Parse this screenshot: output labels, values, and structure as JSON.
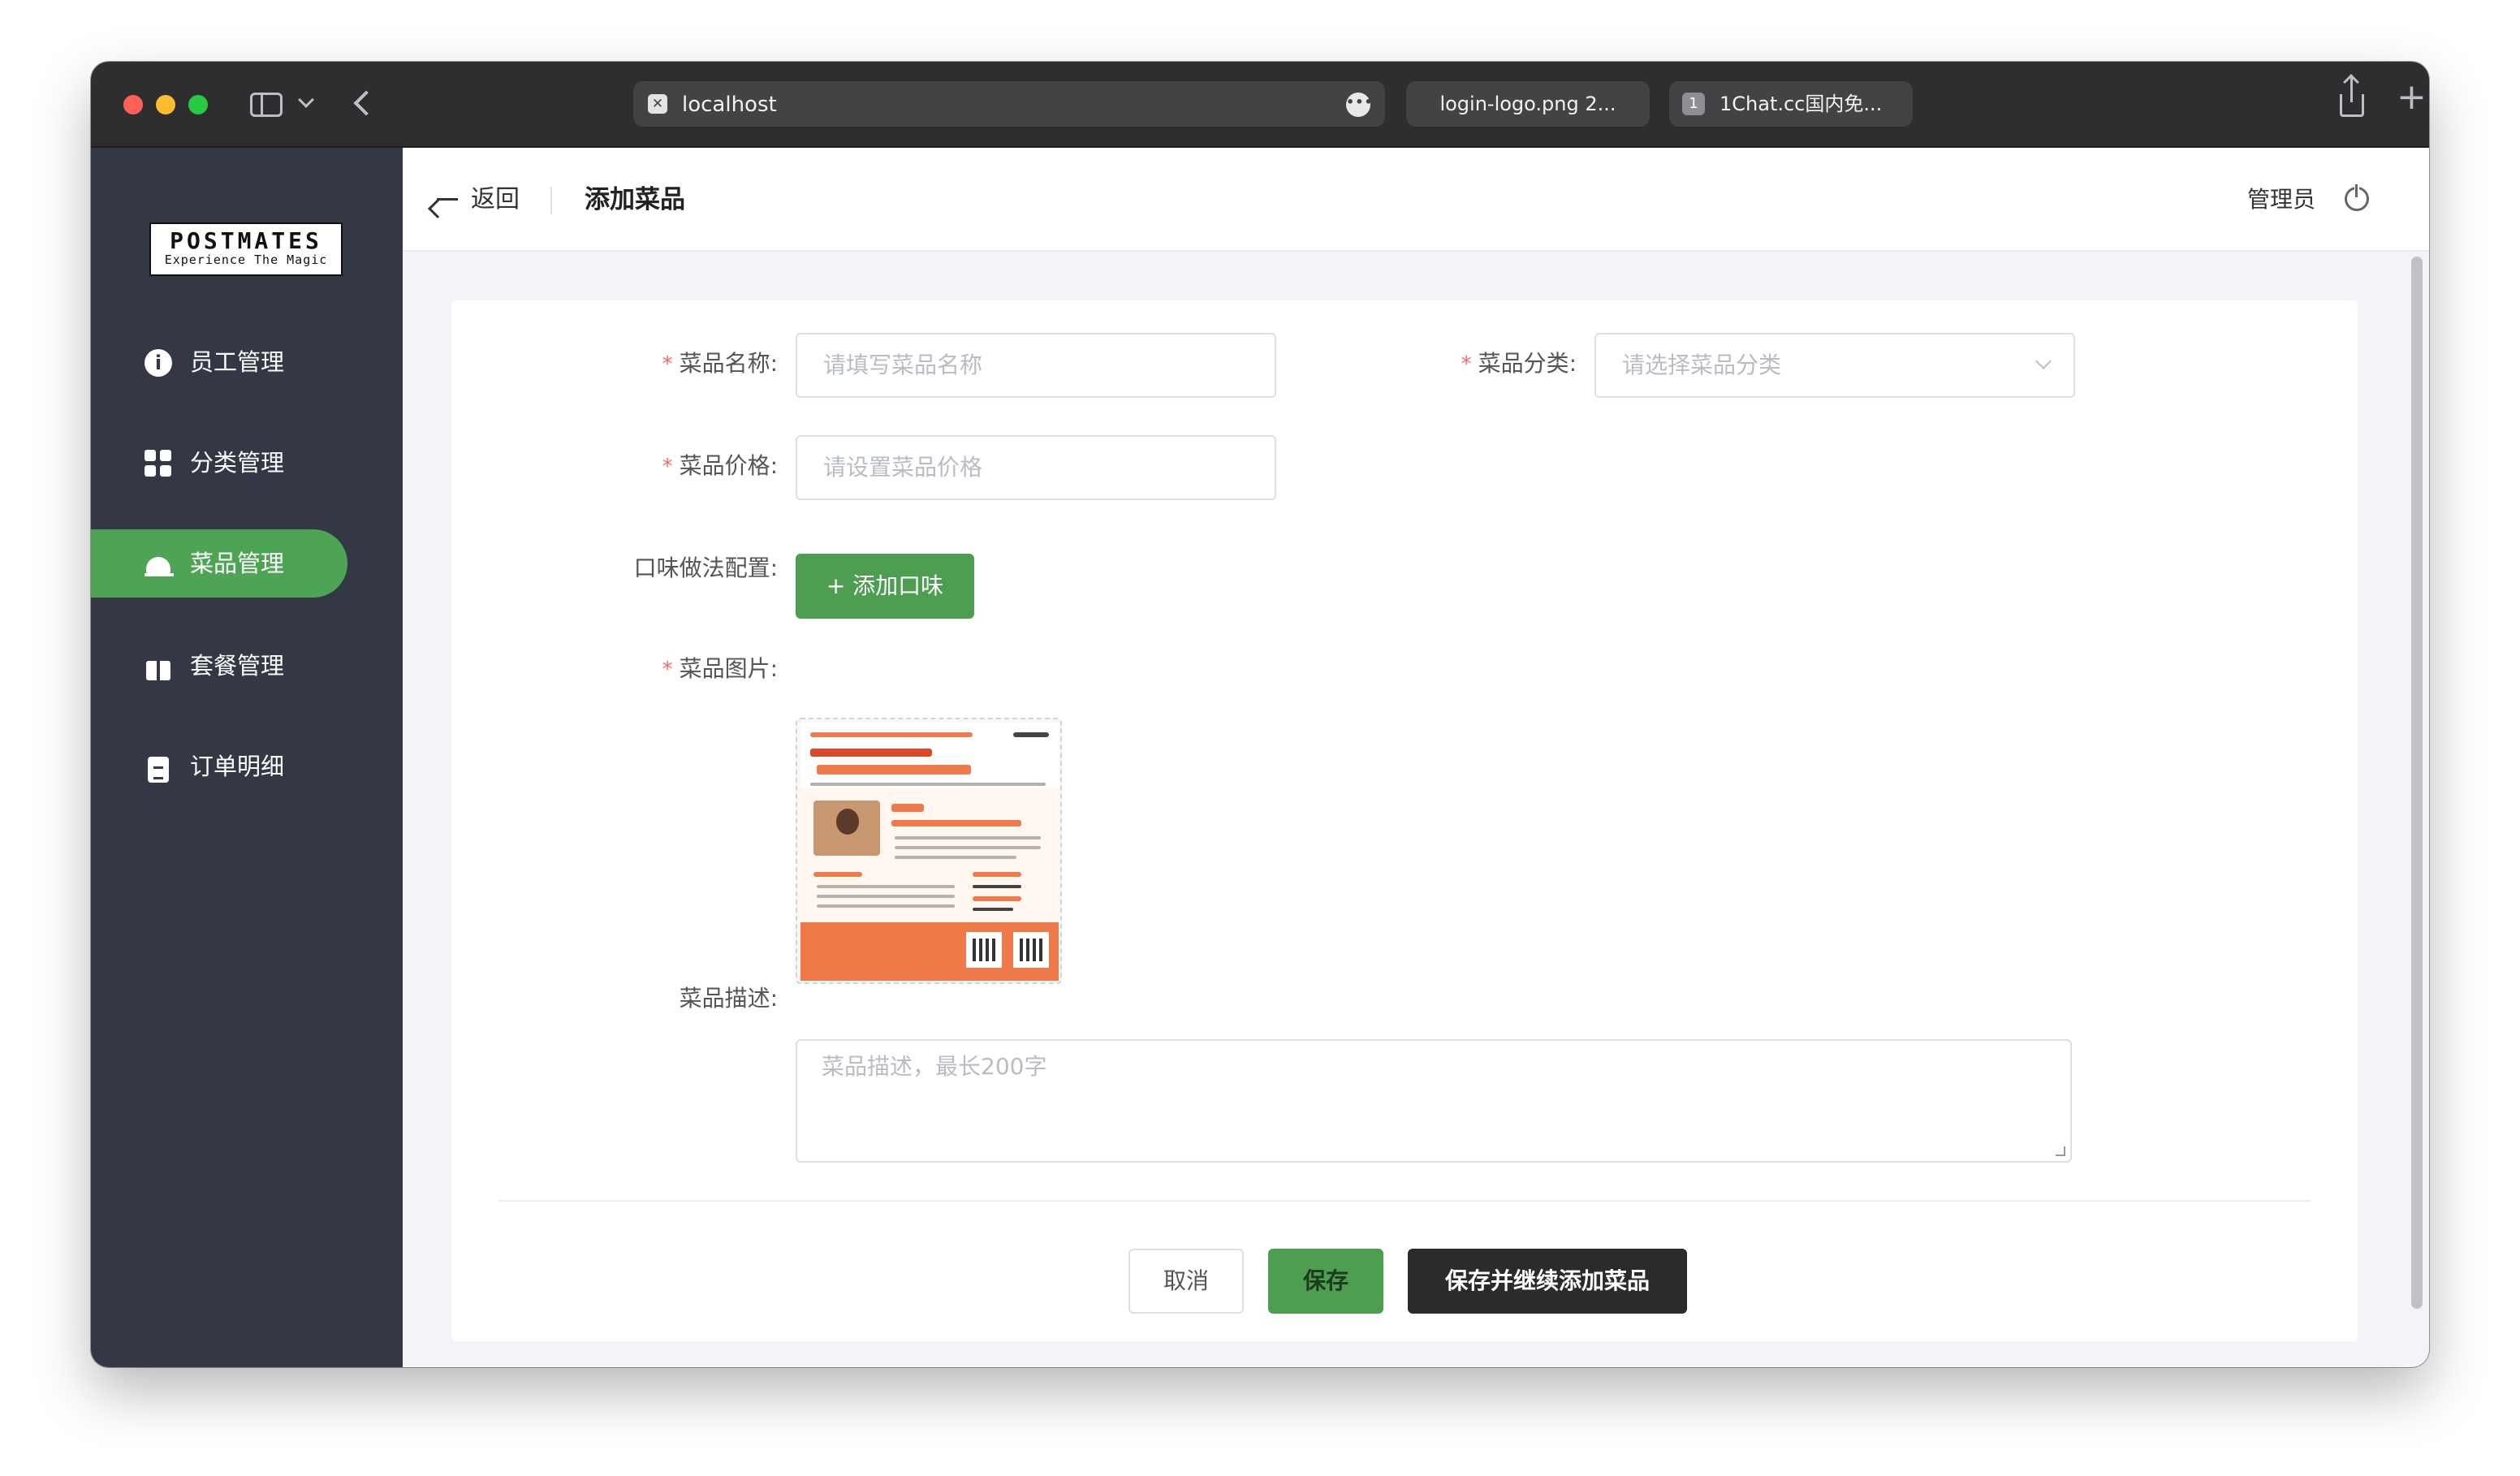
{
  "browser": {
    "address_url": "localhost",
    "address_favicon": "✕",
    "more_glyph": "•••",
    "tabs": [
      {
        "label": "login-logo.png 2..."
      },
      {
        "label": "1Chat.cc国内免...",
        "favicon_text": "1"
      }
    ]
  },
  "sidebar": {
    "logo_brand": "POSTMATES",
    "logo_tagline": "Experience The Magic",
    "items": [
      {
        "label": "员工管理",
        "icon": "info-icon",
        "active": false
      },
      {
        "label": "分类管理",
        "icon": "grid-icon",
        "active": false
      },
      {
        "label": "菜品管理",
        "icon": "cloche-icon",
        "active": true
      },
      {
        "label": "套餐管理",
        "icon": "gift-icon",
        "active": false
      },
      {
        "label": "订单明细",
        "icon": "clipboard-icon",
        "active": false
      }
    ]
  },
  "topbar": {
    "back_label": "返回",
    "page_title": "添加菜品",
    "user_name": "管理员"
  },
  "form": {
    "name_label": "菜品名称:",
    "name_placeholder": "请填写菜品名称",
    "category_label": "菜品分类:",
    "category_placeholder": "请选择菜品分类",
    "price_label": "菜品价格:",
    "price_placeholder": "请设置菜品价格",
    "flavor_label": "口味做法配置:",
    "add_flavor_button": "+ 添加口味",
    "image_label": "菜品图片:",
    "description_label": "菜品描述:",
    "description_placeholder": "菜品描述，最长200字",
    "required_mark": "*"
  },
  "actions": {
    "cancel": "取消",
    "save": "保存",
    "save_and_continue": "保存并继续添加菜品"
  },
  "colors": {
    "sidebar_bg": "#343744",
    "accent_green": "#4da455",
    "dark_button": "#2b2b2b",
    "required_red": "#f56c6c"
  }
}
